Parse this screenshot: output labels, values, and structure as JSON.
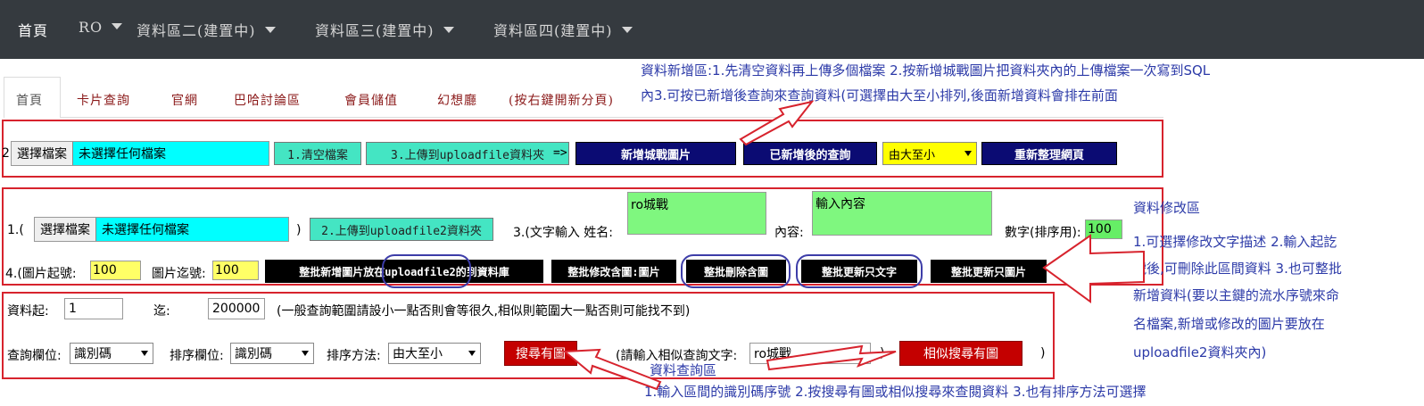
{
  "topnav": {
    "items": [
      {
        "label": "首頁",
        "has_caret": false
      },
      {
        "label": "RO",
        "has_caret": true
      },
      {
        "label": "資料區二(建置中)",
        "has_caret": true
      },
      {
        "label": "資料區三(建置中)",
        "has_caret": true
      },
      {
        "label": "資料區四(建置中)",
        "has_caret": true
      }
    ]
  },
  "tabs": [
    "首頁",
    "卡片查詢",
    "官網",
    "巴哈討論區",
    "會員儲值",
    "幻想廳",
    "(按右鍵開新分頁)"
  ],
  "annotations": {
    "add_area_line1": "資料新增區:1.先清空資料再上傳多個檔案 2.按新增城戰圖片把資料夾內的上傳檔案一次寫到SQL",
    "add_area_line2": "內3.可按已新增後查詢來查詢資料(可選擇由大至小排列,後面新增資料會排在前面",
    "edit_title": "資料修改區",
    "edit_lines": [
      "1.可選擇修改文字描述 2.輸入起訖",
      "號後,可刪除此區間資料 3.也可整批",
      "新增資料(要以主鍵的流水序號來命",
      "名檔案,新增或修改的圖片要放在",
      "uploadfile2資料夾內)"
    ],
    "query_title": "資料查詢區",
    "query_desc": "1.輸入區間的識別碼序號 2.按搜尋有圖或相似搜尋來查閱資料 3.也有排序方法可選擇"
  },
  "section_add": {
    "prefix": "2.",
    "file_button": "選擇檔案",
    "file_status": "未選擇任何檔案",
    "clear_button": "1.清空檔案",
    "upload_button": "3.上傳到uploadfile資料夾",
    "arrow": "=>",
    "add_images_button": "新增城戰圖片",
    "query_added_button": "已新增後的查詢",
    "sort_order": "由大至小",
    "refresh_button": "重新整理網頁"
  },
  "section_edit": {
    "prefix": "1.(",
    "file_button": "選擇檔案",
    "file_status": "未選擇任何檔案",
    "close_paren": ")",
    "upload2_button": "2.上傳到uploadfile2資料夾",
    "text_input_label": "3.(文字輸入 姓名:",
    "name_value": "ro城戰",
    "content_label": "內容:",
    "content_value": "輸入內容",
    "number_label": "數字(排序用):",
    "number_value": "100",
    "row2_prefix": "4.(圖片起號:",
    "start_value": "100",
    "end_label": "圖片迄號:",
    "end_value": "100",
    "batch_add_button": "整批新增圖片放在uploadfile2的到資料庫",
    "batch_edit_button": "整批修改含圖:圖片",
    "batch_delete_button": "整批刪除含圖",
    "batch_update_text_button": "整批更新只文字",
    "batch_update_image_button": "整批更新只圖片",
    "row2_close": ")"
  },
  "section_query": {
    "from_label": "資料起:",
    "from_value": "1",
    "to_label": "迄:",
    "to_value": "200000",
    "range_hint": "(一般查詢範圍請設小一點否則會等很久,相似則範圍大一點否則可能找不到)",
    "field_label": "查詢欄位:",
    "field_value": "識別碼",
    "sort_field_label": "排序欄位:",
    "sort_field_value": "識別碼",
    "sort_method_label": "排序方法:",
    "sort_method_value": "由大至小",
    "search_button": "搜尋有圖",
    "similar_prefix": "(請輸入相似查詢文字:",
    "similar_value": "ro城戰",
    "similar_close": ")",
    "similar_button": "相似搜尋有圖",
    "end_paren": ")"
  },
  "colors": {
    "nav_bg": "#353a3f",
    "annotation_blue": "#2c3aa8",
    "outline_red": "#d7232d",
    "navy_button": "#0b0b73",
    "teal_button": "#44e5c3",
    "cyan_file": "#00ffff"
  }
}
